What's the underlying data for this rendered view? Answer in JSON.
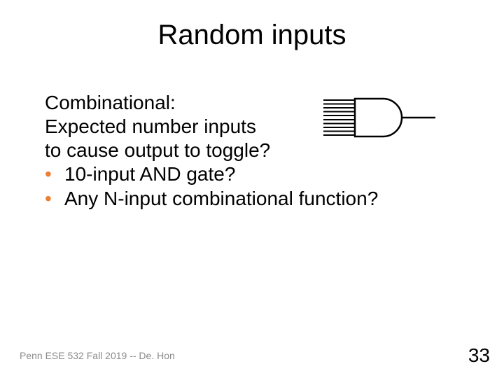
{
  "title": "Random inputs",
  "body": {
    "line1": "Combinational:",
    "line2": "Expected number inputs",
    "line3": "to cause output to toggle?",
    "bullets": [
      {
        "text": "10-input AND gate?"
      },
      {
        "text": "Any N-input combinational function?"
      }
    ]
  },
  "figure": {
    "name": "and-gate-10-input"
  },
  "footer": {
    "left": "Penn ESE 532 Fall 2019 -- De. Hon",
    "page": "33"
  },
  "colors": {
    "accent": "#ed7d31",
    "text": "#000000",
    "footer": "#8a8a8a"
  }
}
